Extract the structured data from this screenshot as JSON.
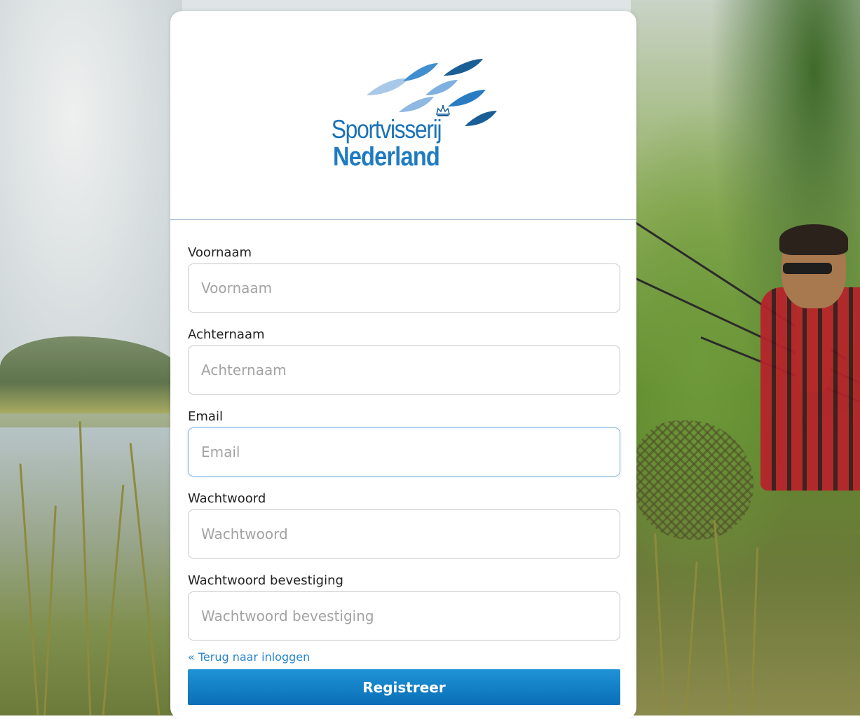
{
  "brand": {
    "line1": "Sportvisserij",
    "line2": "Nederland",
    "colors": {
      "primary": "#1a72b8",
      "fish_light": "#a8c8e8",
      "fish_mid": "#3f8fd0",
      "fish_dark": "#1a5e96"
    }
  },
  "form": {
    "fields": [
      {
        "label": "Voornaam",
        "placeholder": "Voornaam",
        "value": ""
      },
      {
        "label": "Achternaam",
        "placeholder": "Achternaam",
        "value": ""
      },
      {
        "label": "Email",
        "placeholder": "Email",
        "value": ""
      },
      {
        "label": "Wachtwoord",
        "placeholder": "Wachtwoord",
        "value": ""
      },
      {
        "label": "Wachtwoord bevestiging",
        "placeholder": "Wachtwoord bevestiging",
        "value": ""
      }
    ],
    "back_link": "« Terug naar inloggen",
    "submit_label": "Registreer",
    "accent": "#1583c9"
  }
}
